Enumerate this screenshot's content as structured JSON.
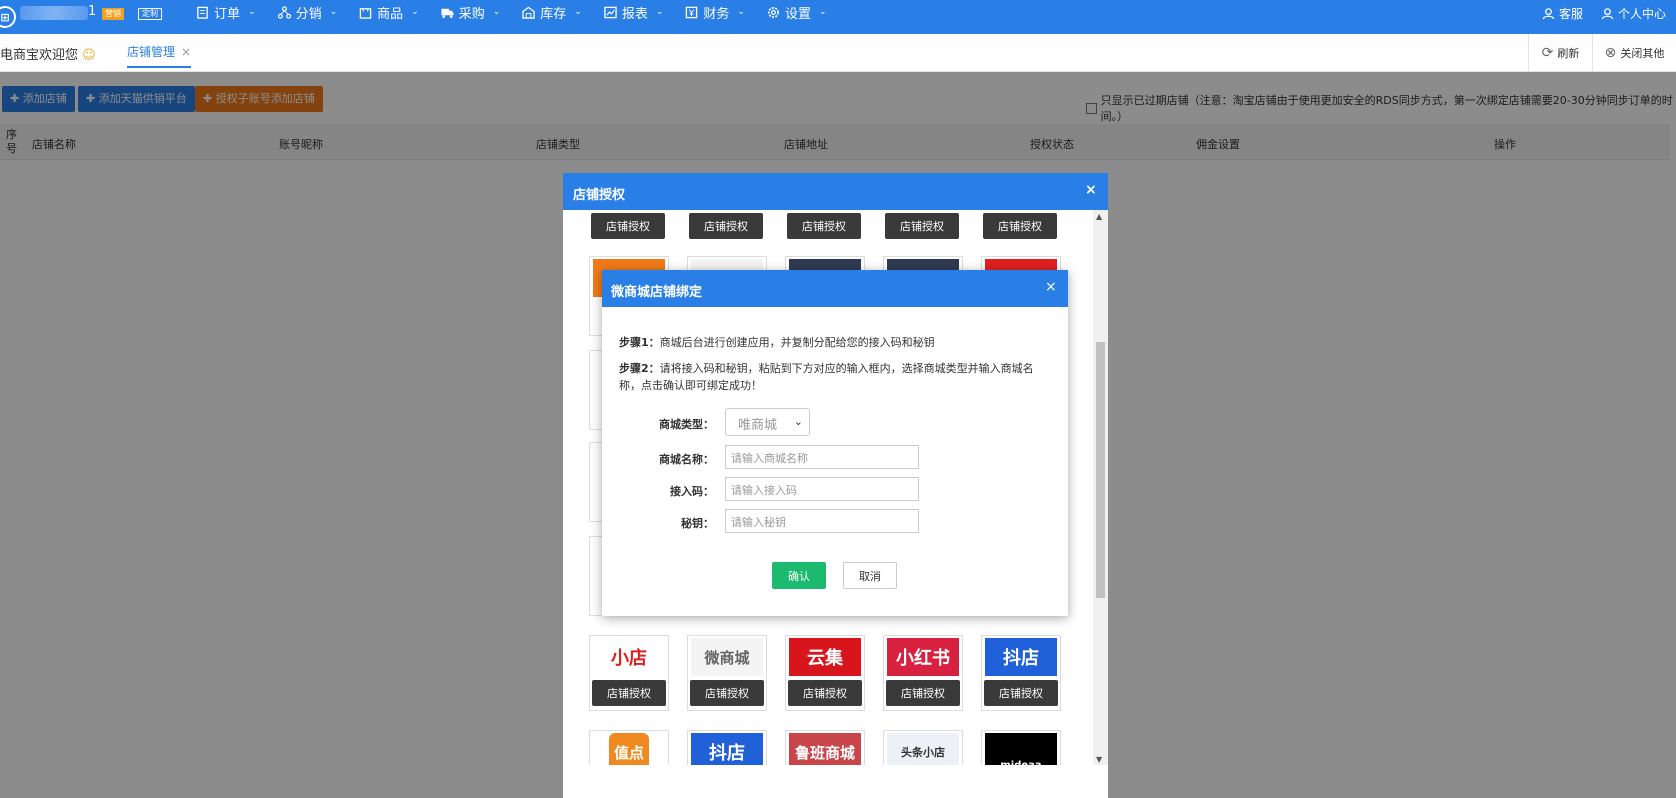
{
  "topbar": {
    "shop_num": "1",
    "tag_marketing": "营销",
    "tag_custom": "定制",
    "nav": [
      {
        "label": "订单",
        "icon": "clipboard-icon"
      },
      {
        "label": "分销",
        "icon": "share-tree-icon"
      },
      {
        "label": "商品",
        "icon": "bag-icon"
      },
      {
        "label": "采购",
        "icon": "truck-icon"
      },
      {
        "label": "库存",
        "icon": "warehouse-icon"
      },
      {
        "label": "报表",
        "icon": "chart-icon"
      },
      {
        "label": "财务",
        "icon": "finance-icon"
      },
      {
        "label": "设置",
        "icon": "gear-icon"
      }
    ],
    "service": "客服",
    "profile": "个人中心"
  },
  "tabs": {
    "welcome": "电商宝欢迎您",
    "active_tab": "店铺管理",
    "close": "×",
    "refresh": "刷新",
    "close_others": "关闭其他"
  },
  "toolbar": {
    "add_shop": "添加店铺",
    "add_tmall": "添加天猫供销平台",
    "auth_sub": "授权子账号添加店铺",
    "only_expired": "只显示已过期店铺（注意：淘宝店铺由于使用更加安全的RDS同步方式，第一次绑定店铺需要20-30分钟同步订单的时间。）"
  },
  "table": {
    "headers": [
      "序号",
      "店铺名称",
      "账号昵称",
      "店铺类型",
      "店铺地址",
      "授权状态",
      "佣金设置",
      "操作"
    ]
  },
  "outer_modal": {
    "title": "店铺授权",
    "close": "×",
    "auth_label": "店铺授权",
    "platforms": [
      "小店",
      "微商城",
      "云集",
      "小红书",
      "抖店",
      "值点",
      "抖店",
      "鲁班商城",
      "头条小店",
      "mideaa"
    ]
  },
  "inner_modal": {
    "title": "微商城店铺绑定",
    "close": "×",
    "step1_label": "步骤1：",
    "step1_text": "商城后台进行创建应用，并复制分配给您的接入码和秘钥",
    "step2_label": "步骤2：",
    "step2_text": "请将接入码和秘钥，粘贴到下方对应的输入框内，选择商城类型并输入商城名称，点击确认即可绑定成功！",
    "type_label": "商城类型：",
    "type_value": "唯商城",
    "name_label": "商城名称：",
    "name_placeholder": "请输入商城名称",
    "code_label": "接入码：",
    "code_placeholder": "请输入接入码",
    "secret_label": "秘钥：",
    "secret_placeholder": "请输入秘钥",
    "confirm": "确认",
    "cancel": "取消"
  },
  "colors": {
    "primary": "#2a7fe6",
    "orange": "#f07a1a",
    "confirm_green": "#1bba6f",
    "dark_btn": "#3a3a3a"
  }
}
